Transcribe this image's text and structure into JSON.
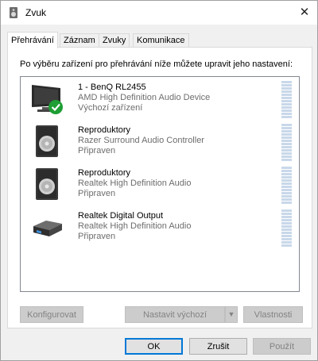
{
  "window": {
    "title": "Zvuk",
    "title_icon": "speaker-icon",
    "close_label": "✕"
  },
  "tabs": [
    {
      "label": "Přehrávání",
      "active": true
    },
    {
      "label": "Záznam",
      "active": false
    },
    {
      "label": "Zvuky",
      "active": false
    },
    {
      "label": "Komunikace",
      "active": false
    }
  ],
  "instruction": "Po výběru zařízení pro přehrávání níže můžete upravit jeho nastavení:",
  "devices": [
    {
      "name": "1 - BenQ RL2455",
      "description": "AMD High Definition Audio Device",
      "status": "Výchozí zařízení",
      "icon": "monitor-icon",
      "default": true
    },
    {
      "name": "Reproduktory",
      "description": "Razer Surround Audio Controller",
      "status": "Připraven",
      "icon": "speaker-icon"
    },
    {
      "name": "Reproduktory",
      "description": "Realtek High Definition Audio",
      "status": "Připraven",
      "icon": "speaker-icon"
    },
    {
      "name": "Realtek Digital Output",
      "description": "Realtek High Definition Audio",
      "status": "Připraven",
      "icon": "digital-output-icon"
    }
  ],
  "panel_buttons": {
    "configure": "Konfigurovat",
    "set_default": "Nastavit výchozí",
    "properties": "Vlastnosti"
  },
  "dialog_buttons": {
    "ok": "OK",
    "cancel": "Zrušit",
    "apply": "Použít"
  },
  "colors": {
    "accent": "#0078d7",
    "default_check": "#1e9e34",
    "meter": "#c9d8ea"
  }
}
